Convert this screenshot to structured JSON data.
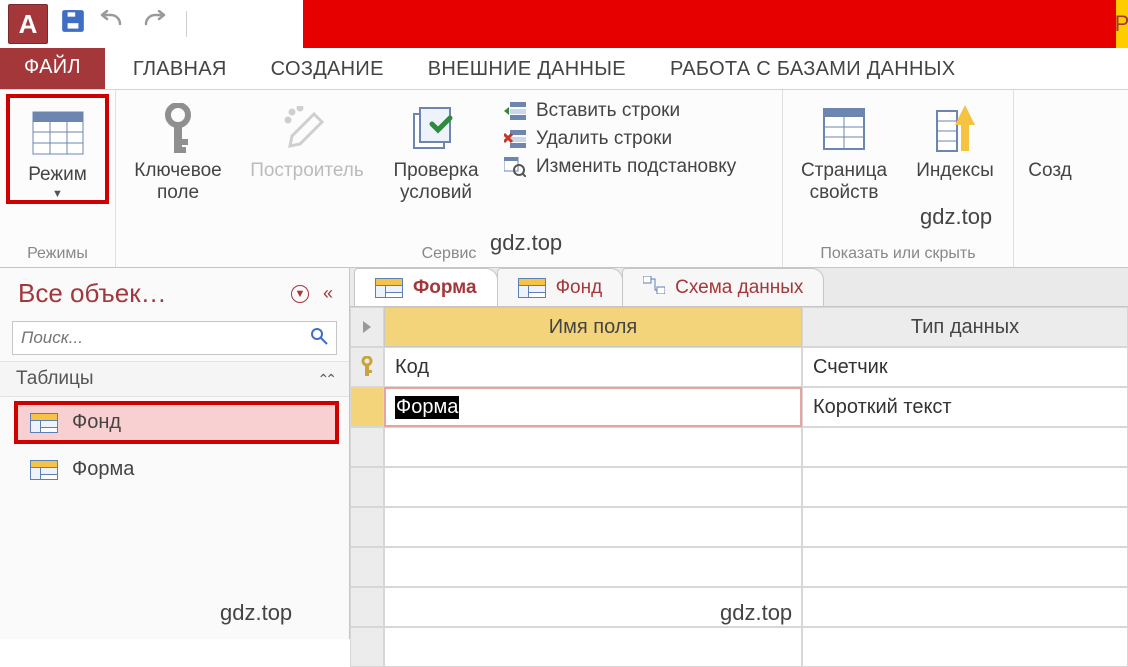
{
  "quickAccess": {
    "logoLetter": "A"
  },
  "titleEdgeLetter": "Р",
  "ribbonTabs": {
    "file": "ФАЙЛ",
    "home": "ГЛАВНАЯ",
    "create": "СОЗДАНИЕ",
    "external": "ВНЕШНИЕ ДАННЫЕ",
    "dbtools": "РАБОТА С БАЗАМИ ДАННЫХ"
  },
  "ribbon": {
    "viewBtn": "Режим",
    "viewGroupLabel": "Режимы",
    "primaryKey": "Ключевое\nполе",
    "builder": "Построитель",
    "validation": "Проверка\nусловий",
    "insertRows": "Вставить строки",
    "deleteRows": "Удалить строки",
    "modifyLookup": "Изменить подстановку",
    "toolsGroupLabel": "Сервис",
    "propertySheet": "Страница\nсвойств",
    "indexes": "Индексы",
    "showHideGroupLabel": "Показать или скрыть",
    "createPartial": "Созд"
  },
  "navPane": {
    "title": "Все объек…",
    "searchPlaceholder": "Поиск...",
    "sectionTables": "Таблицы",
    "items": [
      {
        "label": "Фонд",
        "active": true
      },
      {
        "label": "Форма",
        "active": false
      }
    ]
  },
  "docTabs": [
    {
      "label": "Форма",
      "type": "table",
      "current": true
    },
    {
      "label": "Фонд",
      "type": "table",
      "current": false
    },
    {
      "label": "Схема данных",
      "type": "relation",
      "current": false
    }
  ],
  "designGrid": {
    "headers": {
      "fieldName": "Имя поля",
      "dataType": "Тип данных"
    },
    "rows": [
      {
        "key": true,
        "name": "Код",
        "type": "Счетчик",
        "editing": false
      },
      {
        "key": false,
        "name": "Форма",
        "type": "Короткий текст",
        "editing": true
      }
    ]
  },
  "watermarks": [
    "gdz.top",
    "gdz.top",
    "gdz.top",
    "gdz.top"
  ]
}
